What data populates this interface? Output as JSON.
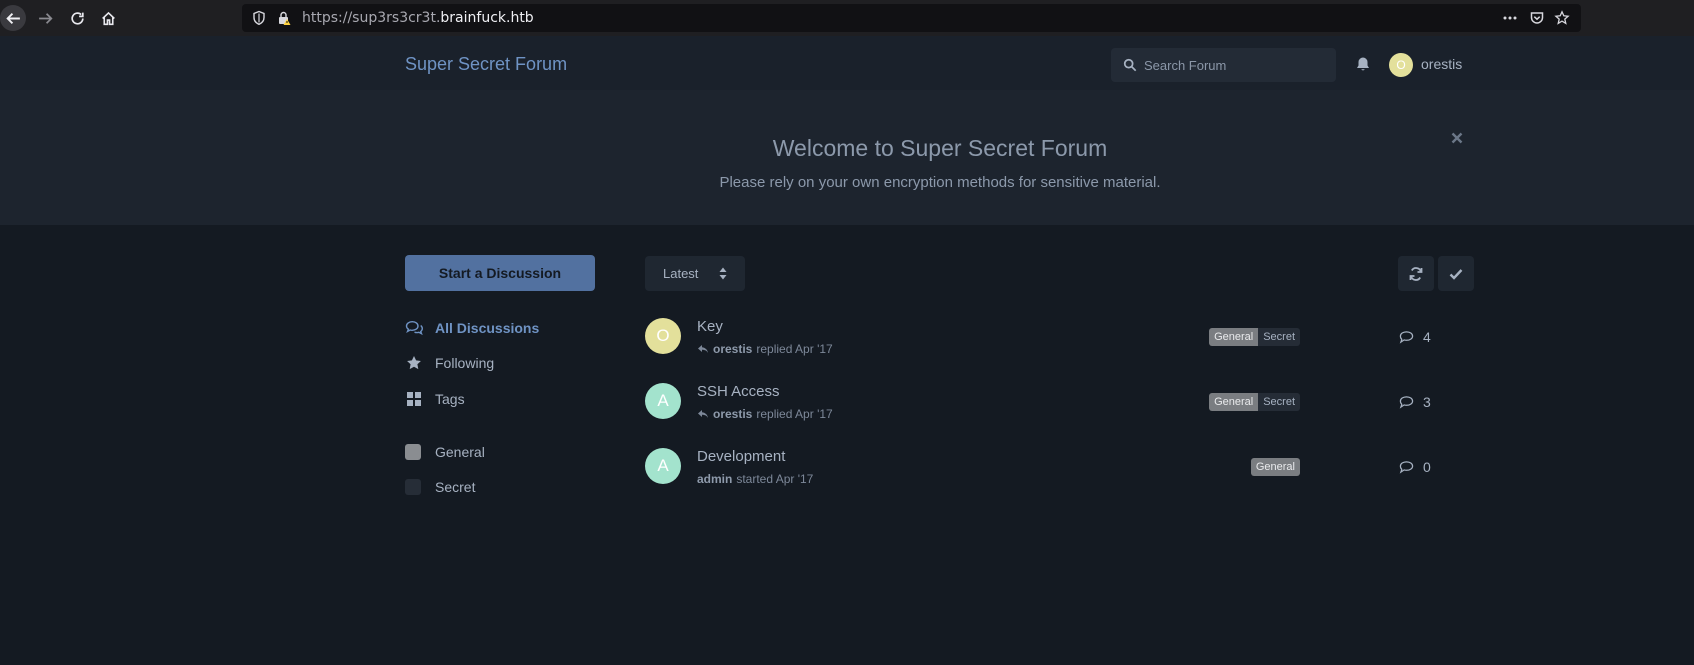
{
  "browser": {
    "url_prefix": "https://sup3rs3cr3t.",
    "url_domain": "brainfuck.htb"
  },
  "header": {
    "site_title": "Super Secret Forum",
    "search_placeholder": "Search Forum",
    "user": {
      "name": "orestis",
      "avatar_letter": "O",
      "avatar_color": "#e3e09b"
    }
  },
  "hero": {
    "title": "Welcome to Super Secret Forum",
    "subtitle": "Please rely on your own encryption methods for sensitive material."
  },
  "sidebar": {
    "start_label": "Start a Discussion",
    "nav": [
      {
        "label": "All Discussions",
        "icon": "comments-icon",
        "active": true
      },
      {
        "label": "Following",
        "icon": "star-icon",
        "active": false
      },
      {
        "label": "Tags",
        "icon": "tags-grid-icon",
        "active": false
      }
    ],
    "tags": [
      {
        "label": "General",
        "color": "#8a8d91"
      },
      {
        "label": "Secret",
        "color": "#262d37"
      }
    ]
  },
  "toolbar": {
    "sort_label": "Latest"
  },
  "discussions": [
    {
      "title": "Key",
      "avatar_letter": "O",
      "avatar_color": "#e3e09b",
      "user": "orestis",
      "action": "replied Apr '17",
      "replied": true,
      "tags": [
        "General",
        "Secret"
      ],
      "replies": "4"
    },
    {
      "title": "SSH Access",
      "avatar_letter": "A",
      "avatar_color": "#a3e3cd",
      "user": "orestis",
      "action": "replied Apr '17",
      "replied": true,
      "tags": [
        "General",
        "Secret"
      ],
      "replies": "3"
    },
    {
      "title": "Development",
      "avatar_letter": "A",
      "avatar_color": "#a3e3cd",
      "user": "admin",
      "action": "started Apr '17",
      "replied": false,
      "tags": [
        "General"
      ],
      "replies": "0"
    }
  ]
}
